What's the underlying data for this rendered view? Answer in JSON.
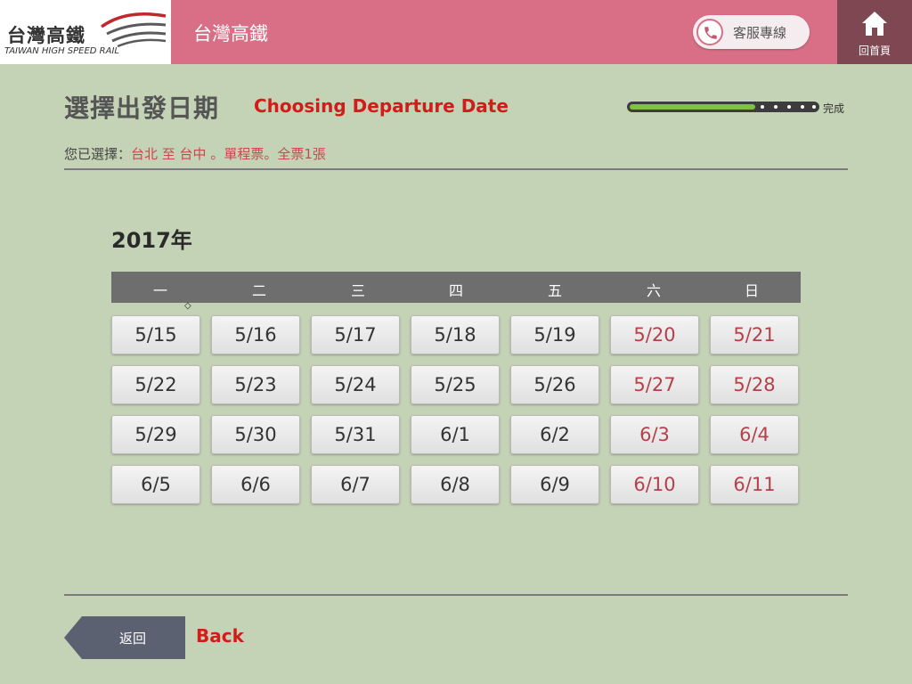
{
  "header": {
    "logo_zh": "台灣高鐵",
    "logo_en": "TAIWAN HIGH SPEED RAIL",
    "title": "台灣高鐵",
    "service_label": "客服專線",
    "service_icon": "phone-icon",
    "home_label": "回首頁",
    "home_icon": "home-icon"
  },
  "page": {
    "title": "選擇出發日期",
    "title_en": "Choosing Departure Date",
    "progress_label": "完成",
    "progress_fraction": 0.67,
    "selection_prefix": "您已選擇：",
    "selection_value": "台北 至 台中 。單程票。全票1張"
  },
  "calendar": {
    "year": "2017年",
    "weekdays": [
      "一",
      "二",
      "三",
      "四",
      "五",
      "六",
      "日"
    ],
    "weeks": [
      [
        "5/15",
        "5/16",
        "5/17",
        "5/18",
        "5/19",
        "5/20",
        "5/21"
      ],
      [
        "5/22",
        "5/23",
        "5/24",
        "5/25",
        "5/26",
        "5/27",
        "5/28"
      ],
      [
        "5/29",
        "5/30",
        "5/31",
        "6/1",
        "6/2",
        "6/3",
        "6/4"
      ],
      [
        "6/5",
        "6/6",
        "6/7",
        "6/8",
        "6/9",
        "6/10",
        "6/11"
      ]
    ]
  },
  "footer": {
    "back_label": "返回",
    "back_en": "Back"
  },
  "colors": {
    "background": "#c4d3b5",
    "header": "#d86f87",
    "home_button": "#7e4752",
    "accent_red": "#d51a1a",
    "weekend_text": "#b5404a",
    "progress_green": "#7fc241"
  }
}
